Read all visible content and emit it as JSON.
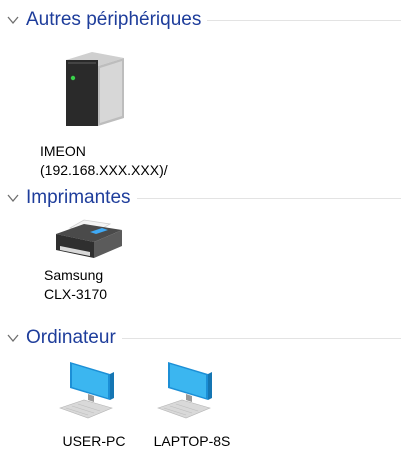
{
  "groups": [
    {
      "title": "Autres périphériques",
      "items": [
        {
          "label": "IMEON\n(192.168.XXX.XXX)/",
          "icon": "device-tower-icon"
        }
      ]
    },
    {
      "title": "Imprimantes",
      "items": [
        {
          "label": "Samsung\nCLX-3170",
          "icon": "printer-icon"
        }
      ]
    },
    {
      "title": "Ordinateur",
      "items": [
        {
          "label": "USER-PC",
          "icon": "computer-monitor-icon"
        },
        {
          "label": "LAPTOP-8S",
          "icon": "computer-monitor-icon"
        }
      ]
    }
  ],
  "colors": {
    "group_title": "#1e3d9b",
    "divider": "#e3e3e3",
    "monitor_screen": "#29a8e6"
  }
}
